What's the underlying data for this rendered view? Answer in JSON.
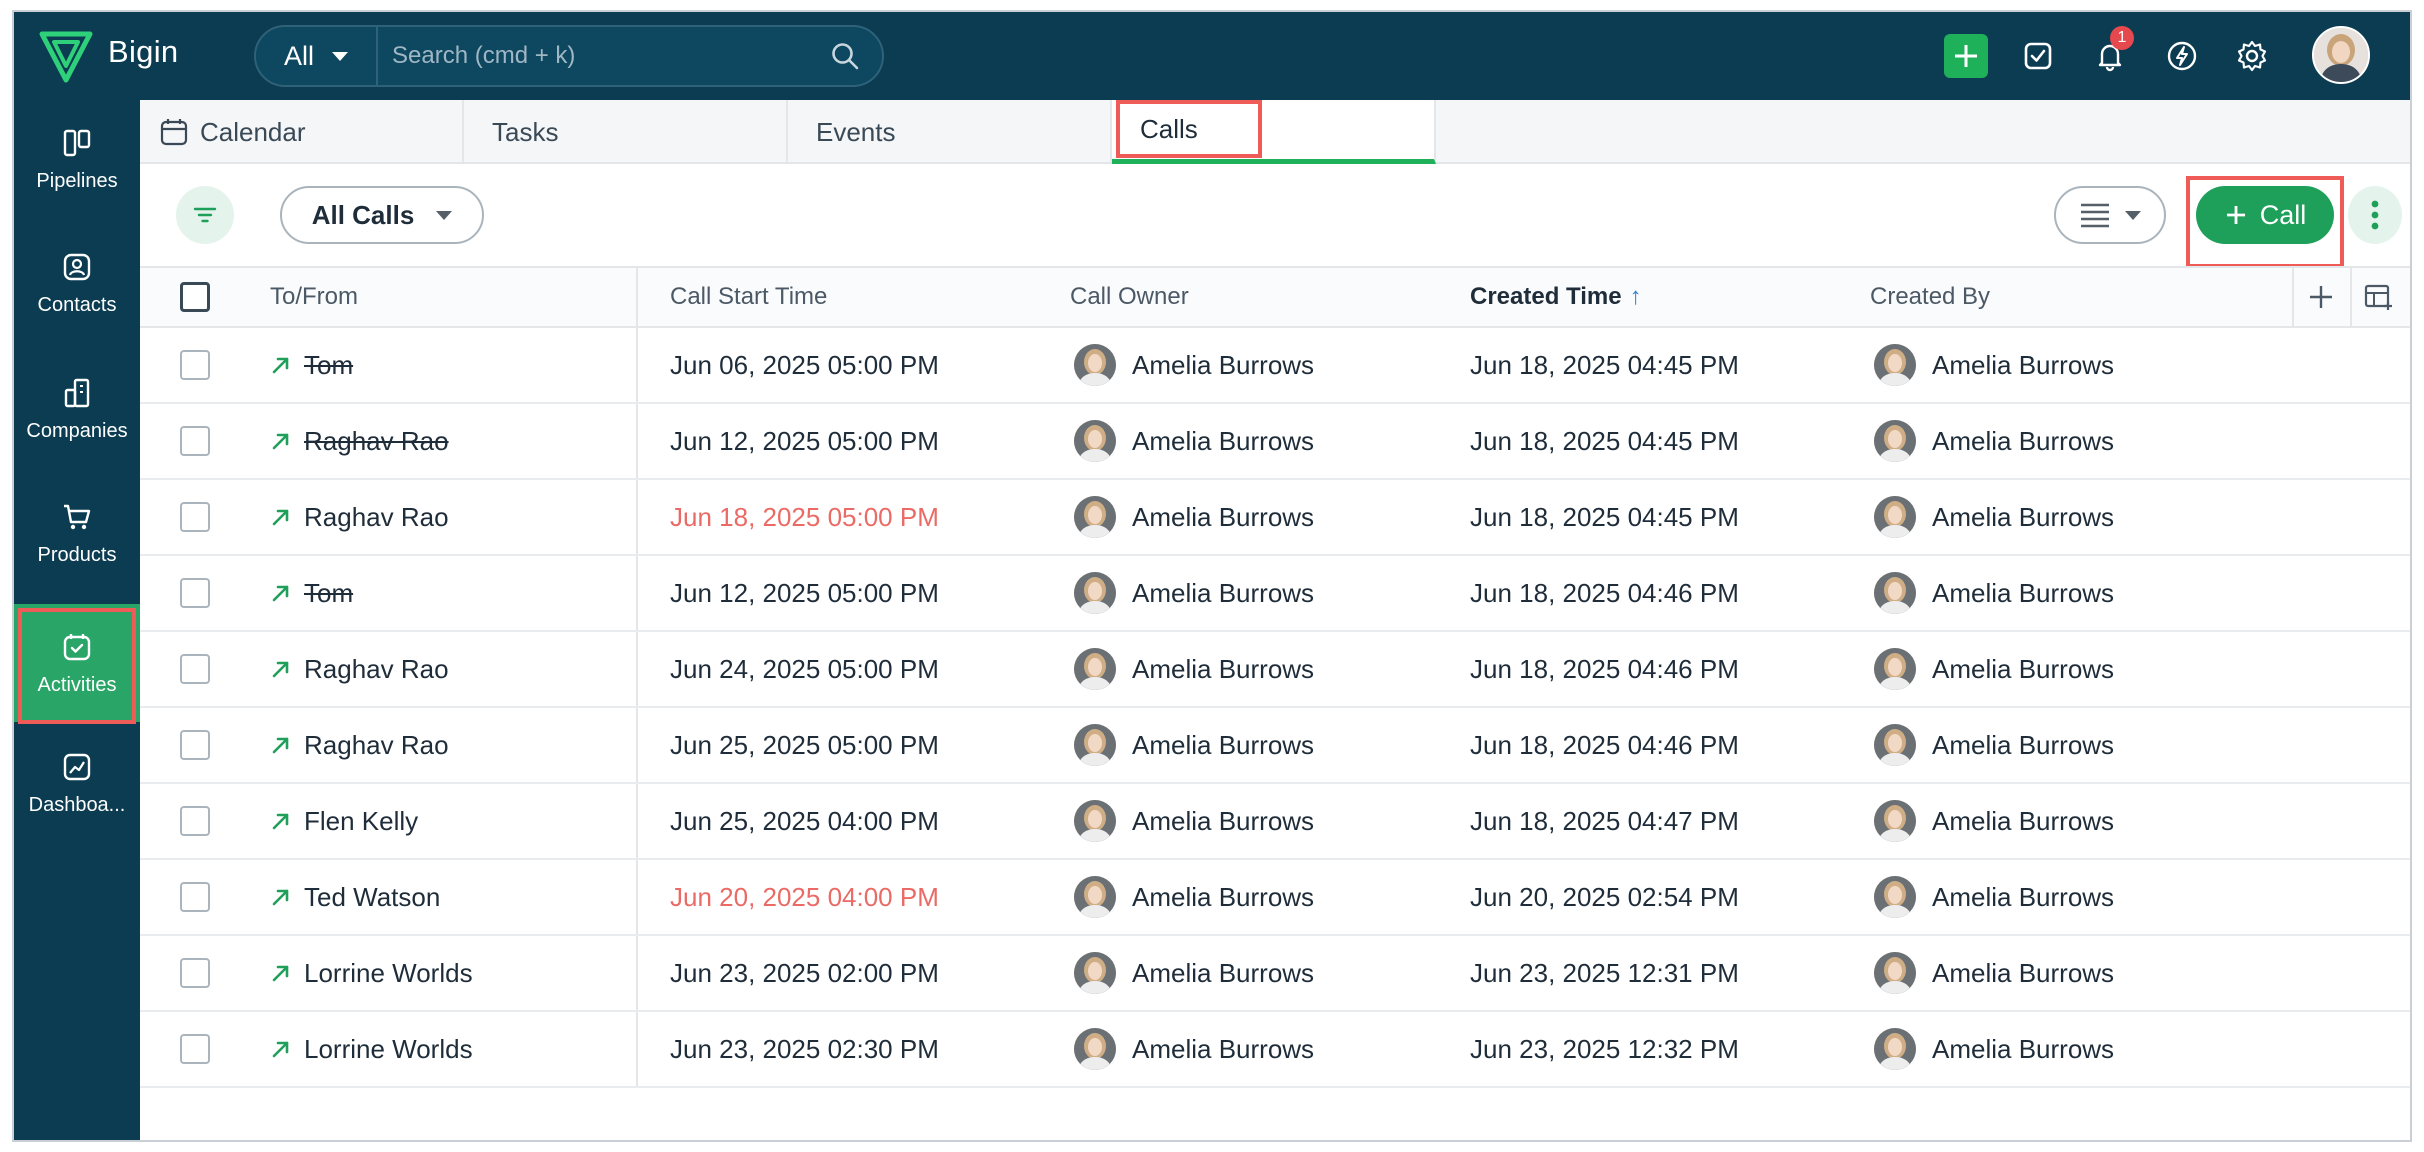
{
  "app": {
    "brand": "Bigin"
  },
  "search": {
    "scope": "All",
    "placeholder": "Search (cmd + k)"
  },
  "header": {
    "notification_count": "1"
  },
  "sidebar": {
    "items": [
      {
        "label": "Pipelines",
        "icon": "pipelines-icon"
      },
      {
        "label": "Contacts",
        "icon": "contacts-icon"
      },
      {
        "label": "Companies",
        "icon": "companies-icon"
      },
      {
        "label": "Products",
        "icon": "products-icon"
      },
      {
        "label": "Activities",
        "icon": "activities-icon",
        "active": true
      },
      {
        "label": "Dashboa...",
        "icon": "dashboards-icon"
      }
    ]
  },
  "tabs": [
    {
      "label": "Calendar"
    },
    {
      "label": "Tasks"
    },
    {
      "label": "Events"
    },
    {
      "label": "Calls",
      "active": true
    }
  ],
  "toolbar": {
    "view_filter": "All Calls",
    "call_button": "Call"
  },
  "table": {
    "columns": [
      "To/From",
      "Call Start Time",
      "Call Owner",
      "Created Time",
      "Created By"
    ],
    "sorted_column": "Created Time",
    "sort_direction": "ascending",
    "rows": [
      {
        "to_from": "Tom",
        "struck": true,
        "start": "Jun 06, 2025 05:00 PM",
        "overdue": false,
        "owner": "Amelia Burrows",
        "created": "Jun 18, 2025 04:45 PM",
        "created_by": "Amelia Burrows"
      },
      {
        "to_from": "Raghav Rao",
        "struck": true,
        "start": "Jun 12, 2025 05:00 PM",
        "overdue": false,
        "owner": "Amelia Burrows",
        "created": "Jun 18, 2025 04:45 PM",
        "created_by": "Amelia Burrows"
      },
      {
        "to_from": "Raghav Rao",
        "struck": false,
        "start": "Jun 18, 2025 05:00 PM",
        "overdue": true,
        "owner": "Amelia Burrows",
        "created": "Jun 18, 2025 04:45 PM",
        "created_by": "Amelia Burrows"
      },
      {
        "to_from": "Tom",
        "struck": true,
        "start": "Jun 12, 2025 05:00 PM",
        "overdue": false,
        "owner": "Amelia Burrows",
        "created": "Jun 18, 2025 04:46 PM",
        "created_by": "Amelia Burrows"
      },
      {
        "to_from": "Raghav Rao",
        "struck": false,
        "start": "Jun 24, 2025 05:00 PM",
        "overdue": false,
        "owner": "Amelia Burrows",
        "created": "Jun 18, 2025 04:46 PM",
        "created_by": "Amelia Burrows"
      },
      {
        "to_from": "Raghav Rao",
        "struck": false,
        "start": "Jun 25, 2025 05:00 PM",
        "overdue": false,
        "owner": "Amelia Burrows",
        "created": "Jun 18, 2025 04:46 PM",
        "created_by": "Amelia Burrows"
      },
      {
        "to_from": "Flen Kelly",
        "struck": false,
        "start": "Jun 25, 2025 04:00 PM",
        "overdue": false,
        "owner": "Amelia Burrows",
        "created": "Jun 18, 2025 04:47 PM",
        "created_by": "Amelia Burrows"
      },
      {
        "to_from": "Ted Watson",
        "struck": false,
        "start": "Jun 20, 2025 04:00 PM",
        "overdue": true,
        "owner": "Amelia Burrows",
        "created": "Jun 20, 2025 02:54 PM",
        "created_by": "Amelia Burrows"
      },
      {
        "to_from": "Lorrine Worlds",
        "struck": false,
        "start": "Jun 23, 2025 02:00 PM",
        "overdue": false,
        "owner": "Amelia Burrows",
        "created": "Jun 23, 2025 12:31 PM",
        "created_by": "Amelia Burrows"
      },
      {
        "to_from": "Lorrine Worlds",
        "struck": false,
        "start": "Jun 23, 2025 02:30 PM",
        "overdue": false,
        "owner": "Amelia Burrows",
        "created": "Jun 23, 2025 12:32 PM",
        "created_by": "Amelia Burrows"
      }
    ]
  },
  "colors": {
    "header_bg": "#0b3c51",
    "accent_green": "#1fa05a",
    "active_nav": "#2aa568",
    "overdue_red": "#ea6b66",
    "highlight_red": "#ef5b57",
    "sort_blue": "#2f7fd6"
  }
}
